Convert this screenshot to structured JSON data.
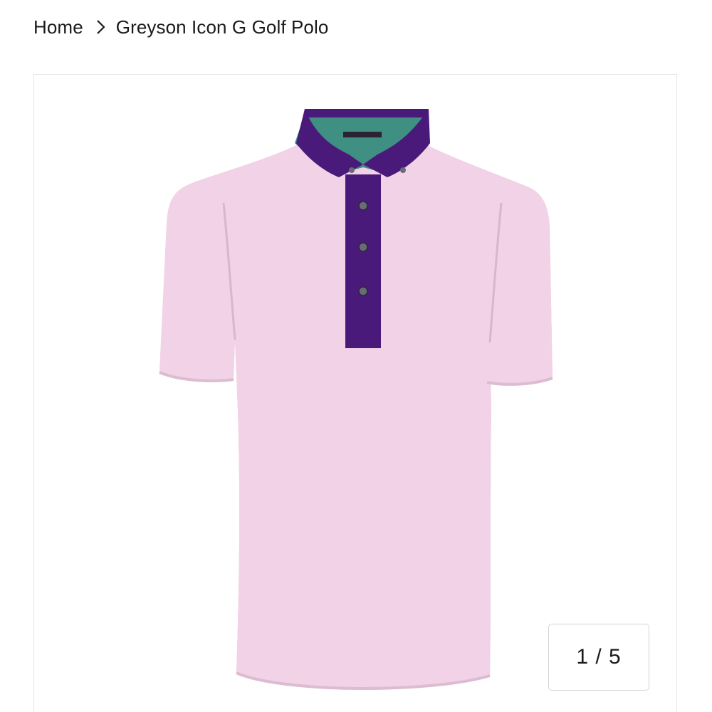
{
  "breadcrumb": {
    "home_label": "Home",
    "separator_icon": "chevron-right-icon",
    "current_label": "Greyson Icon G Golf Polo"
  },
  "gallery": {
    "image_subject": "polo-shirt",
    "shirt_color": "#f1d2e6",
    "accent_color": "#4a1a7a",
    "collar_lining_color": "#3f8f82",
    "counter": "1 / 5"
  }
}
